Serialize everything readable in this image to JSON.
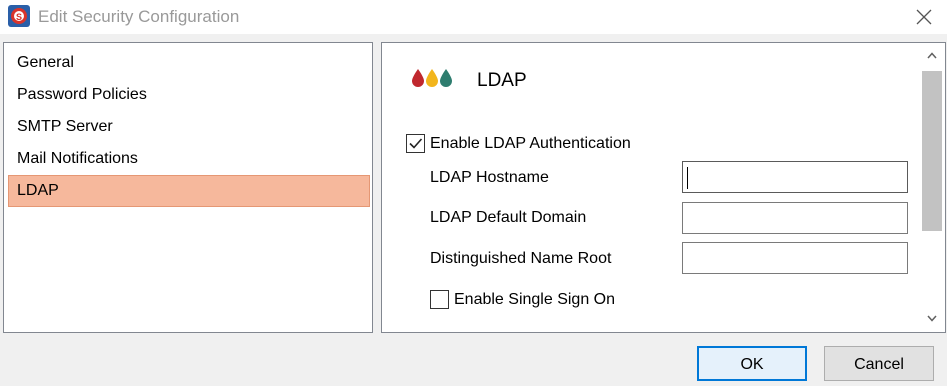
{
  "window": {
    "title": "Edit Security Configuration",
    "icons": {
      "app": "app-logo-icon",
      "close": "close-icon"
    }
  },
  "nav": {
    "items": [
      {
        "label": "General",
        "selected": false
      },
      {
        "label": "Password Policies",
        "selected": false
      },
      {
        "label": "SMTP Server",
        "selected": false
      },
      {
        "label": "Mail Notifications",
        "selected": false
      },
      {
        "label": "LDAP",
        "selected": true
      }
    ],
    "selected_bg": "#f6b89c"
  },
  "content": {
    "section_title": "LDAP",
    "section_icon": "droplets-icon",
    "enable_ldap": {
      "label": "Enable LDAP Authentication",
      "checked": true
    },
    "fields": [
      {
        "label": "LDAP Hostname",
        "value": "",
        "focused": true
      },
      {
        "label": "LDAP Default Domain",
        "value": "",
        "focused": false
      },
      {
        "label": "Distinguished Name Root",
        "value": "",
        "focused": false
      }
    ],
    "enable_sso": {
      "label": "Enable Single Sign On",
      "checked": false
    }
  },
  "footer": {
    "ok_label": "OK",
    "cancel_label": "Cancel",
    "accent": "#0078d7"
  }
}
